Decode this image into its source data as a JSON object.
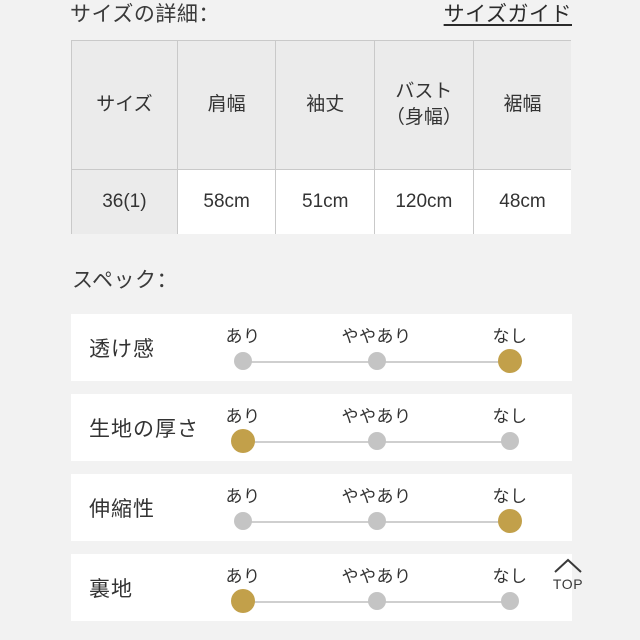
{
  "colors": {
    "page_background": "#f2f2f2",
    "card_background": "#ffffff",
    "accent_gold": "#c2a04a",
    "inactive_gray": "#c4c4c4",
    "text": "#333333",
    "table_header_background": "#ebebeb",
    "table_border": "#c9c9c9"
  },
  "size_section": {
    "title": "サイズの詳細：",
    "guide_link": "サイズガイド",
    "table": {
      "headers": [
        "サイズ",
        "肩幅",
        "袖丈",
        "バスト（身幅）",
        "裾幅",
        ""
      ],
      "rows": [
        {
          "cells": [
            "36(1)",
            "58cm",
            "51cm",
            "120cm",
            "48cm",
            ""
          ]
        }
      ]
    }
  },
  "spec_section": {
    "title": "スペック：",
    "scale_labels": [
      "あり",
      "ややあり",
      "なし"
    ],
    "rows": [
      {
        "label": "透け感",
        "selected_index": 2
      },
      {
        "label": "生地の厚さ",
        "selected_index": 0
      },
      {
        "label": "伸縮性",
        "selected_index": 2
      },
      {
        "label": "裏地",
        "selected_index": 0
      }
    ]
  },
  "back_to_top": {
    "icon": "chevron-up-icon",
    "label": "TOP"
  }
}
